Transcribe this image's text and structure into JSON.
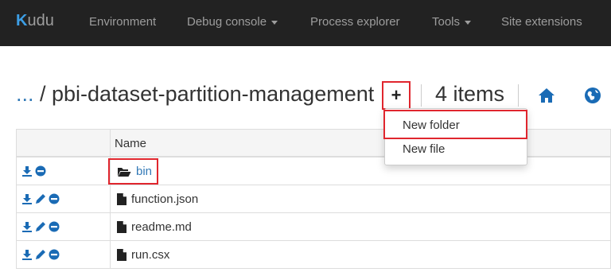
{
  "navbar": {
    "brand_k": "K",
    "brand_rest": "udu",
    "items": [
      {
        "label": "Environment",
        "dropdown": false
      },
      {
        "label": "Debug console",
        "dropdown": true
      },
      {
        "label": "Process explorer",
        "dropdown": false
      },
      {
        "label": "Tools",
        "dropdown": true
      },
      {
        "label": "Site extensions",
        "dropdown": false
      }
    ]
  },
  "header": {
    "ellipsis": "...",
    "path": " / pbi-dataset-partition-management",
    "add_button": "+",
    "item_count": "4 items"
  },
  "menu": {
    "items": [
      "New folder",
      "New file"
    ]
  },
  "table": {
    "column_name": "Name",
    "rows": [
      {
        "name": "bin",
        "type": "folder"
      },
      {
        "name": "function.json",
        "type": "file"
      },
      {
        "name": "readme.md",
        "type": "file"
      },
      {
        "name": "run.csx",
        "type": "file"
      }
    ]
  },
  "colors": {
    "navbar_bg": "#222222",
    "link": "#337ab7",
    "action_blue": "#1a6bb5",
    "highlight_red": "#e0262e"
  },
  "icons": [
    "download-icon",
    "edit-icon",
    "delete-icon",
    "folder-open-icon",
    "file-icon",
    "home-icon",
    "globe-icon"
  ]
}
